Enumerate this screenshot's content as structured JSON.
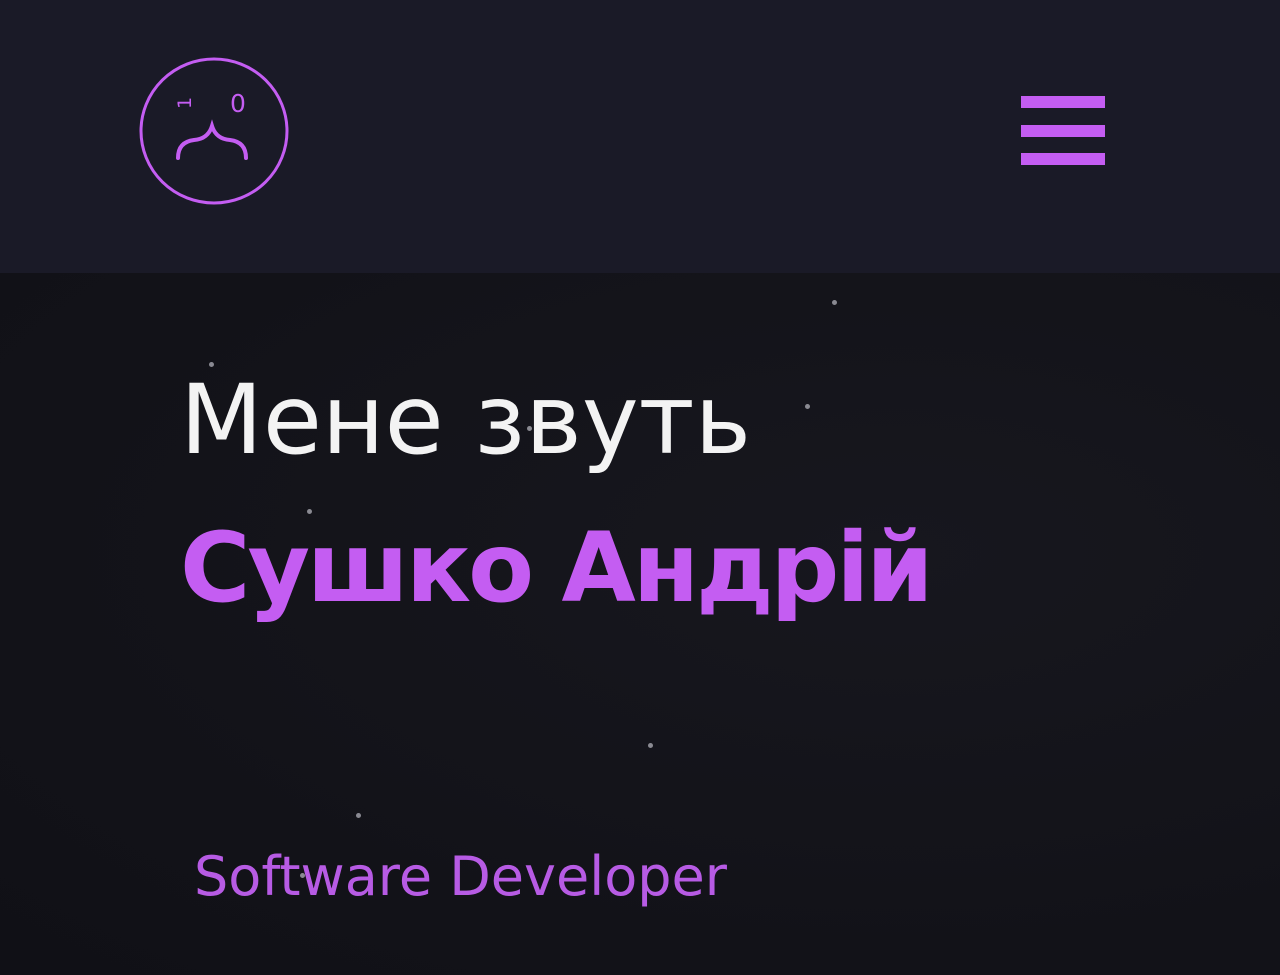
{
  "header": {
    "logo": {
      "icon": "face-logo-icon",
      "left_eye_text": "1",
      "right_eye_text": "0",
      "color": "#c45df2"
    },
    "menu_icon": "hamburger-menu-icon"
  },
  "hero": {
    "intro": "Мене звуть",
    "name": "Сушко Андрій",
    "role": "Software Developer"
  },
  "colors": {
    "accent": "#c45df2",
    "header_bg": "#1a1a27",
    "page_bg": "#14141b",
    "text": "#f3f3f3"
  }
}
